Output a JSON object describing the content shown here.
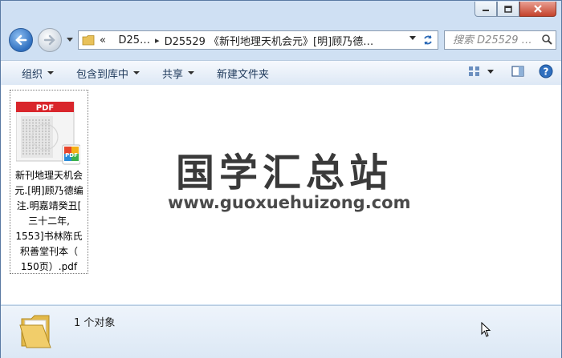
{
  "window": {
    "caption": {
      "minimize_icon": "minimize-icon",
      "maximize_icon": "maximize-icon",
      "close_icon": "close-icon"
    }
  },
  "navigation": {
    "breadcrumb_root_marker": "«",
    "breadcrumb_segments": [
      "D25…",
      "D25529 《新刊地理天机会元》[明]顾乃德…"
    ],
    "search_placeholder": "搜索 D25529 …"
  },
  "toolbar": {
    "items": [
      {
        "label": "组织",
        "has_dropdown": true
      },
      {
        "label": "包含到库中",
        "has_dropdown": true
      },
      {
        "label": "共享",
        "has_dropdown": true
      },
      {
        "label": "新建文件夹",
        "has_dropdown": false
      }
    ]
  },
  "files": [
    {
      "name": "新刊地理天机会元.[明]顾乃德编注.明嘉靖癸丑[三十二年,1553]书林陈氏积善堂刊本（150页）.pdf",
      "name_lines": [
        "新刊地理天机会",
        "元.[明]顾乃德编",
        "注.明嘉靖癸丑[",
        "三十二年,",
        "1553]书林陈氏",
        "积善堂刊本（",
        "150页）.pdf"
      ],
      "type_badge": "PDF",
      "icon_badge": "PDF"
    }
  ],
  "watermark": {
    "title": "国学汇总站",
    "url": "www.guoxuehuizong.com"
  },
  "details": {
    "count_text": "1 个对象"
  },
  "colors": {
    "pdf_red": "#d9262c",
    "window_frame": "#cfe0f3",
    "toolbar_text": "#1e395b"
  }
}
